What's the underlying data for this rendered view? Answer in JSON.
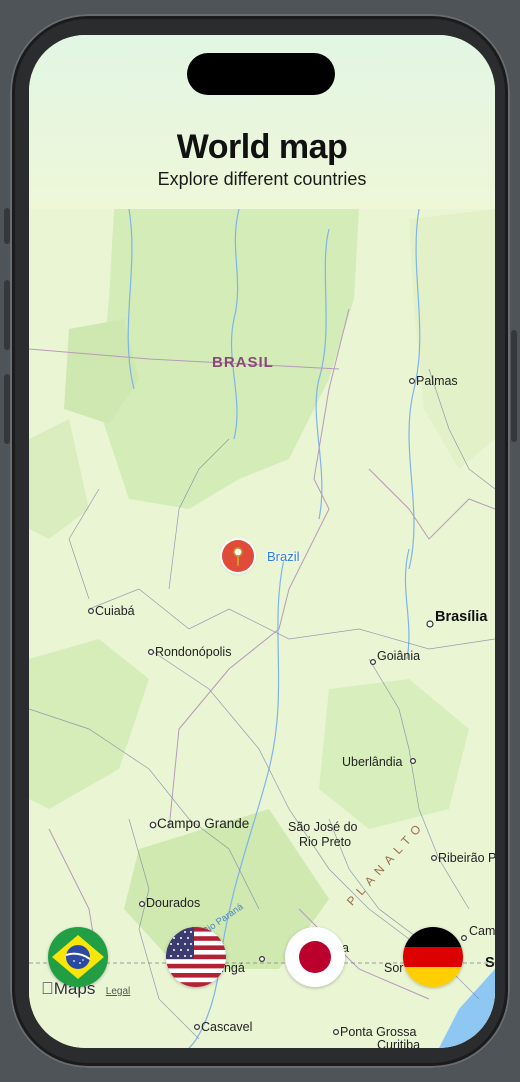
{
  "header": {
    "title": "World map",
    "subtitle": "Explore different countries"
  },
  "map": {
    "country_label": "BRASIL",
    "pin_label": "Brazil",
    "region_label": "PLANALTO",
    "river_label": "Rio Paraná",
    "cities": {
      "palmas": "Palmas",
      "cuiaba": "Cuiabá",
      "brasilia": "Brasília",
      "rondonopolis": "Rondonópolis",
      "goiania": "Goiânia",
      "uberlandia": "Uberlândia",
      "campo_grande": "Campo Grande",
      "sao_jose_line1": "São José do",
      "sao_jose_line2": "Rio Preto",
      "ribeirao": "Ribeirão P",
      "dourados": "Dourados",
      "cascavel": "Cascavel",
      "ponta_grossa": "Ponta Grossa",
      "curitiba": "Curitiba",
      "cam_partial": "Cam",
      "sor_partial": "Sor",
      "s_partial": "S",
      "ringa_partial": "ringá",
      "a_partial": "a"
    },
    "attribution": {
      "logo": "Maps",
      "legal": "Legal"
    }
  },
  "flags": [
    {
      "country": "Brazil",
      "icon": "brazil-flag-icon",
      "colors": [
        "#229e45",
        "#f8e509",
        "#2b49a3"
      ]
    },
    {
      "country": "United States",
      "icon": "usa-flag-icon",
      "colors": [
        "#b22234",
        "#ffffff",
        "#3c3b6e"
      ]
    },
    {
      "country": "Japan",
      "icon": "japan-flag-icon",
      "colors": [
        "#ffffff",
        "#bc002d"
      ]
    },
    {
      "country": "Germany",
      "icon": "germany-flag-icon",
      "colors": [
        "#000000",
        "#dd0000",
        "#ffce00"
      ]
    }
  ],
  "colors": {
    "pin": "#e04b3a",
    "link": "#2f7de0",
    "land": "#eaf5d4",
    "water": "#8ec7f2"
  }
}
